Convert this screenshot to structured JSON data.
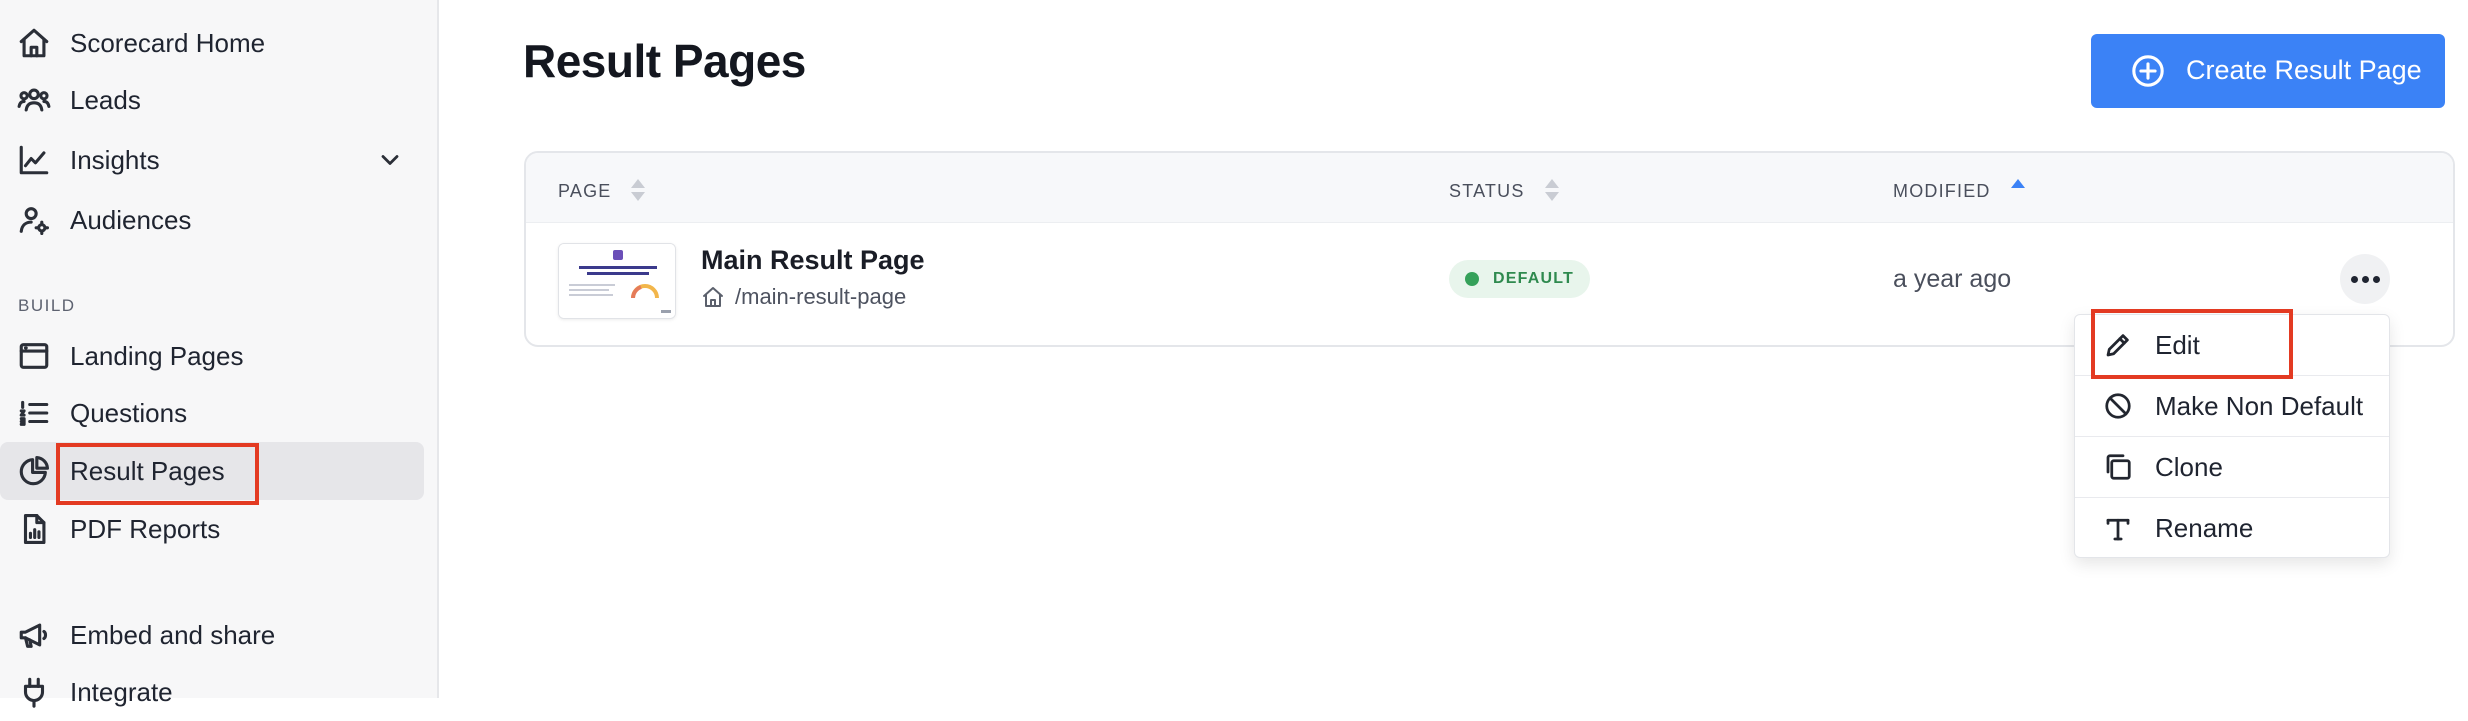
{
  "sidebar": {
    "items": [
      {
        "label": "Scorecard Home",
        "icon": "home-icon"
      },
      {
        "label": "Leads",
        "icon": "users-icon"
      },
      {
        "label": "Insights",
        "icon": "chart-line-icon"
      },
      {
        "label": "Audiences",
        "icon": "user-settings-icon"
      },
      {
        "label": "Landing Pages",
        "icon": "browser-window-icon"
      },
      {
        "label": "Questions",
        "icon": "list-ordered-icon"
      },
      {
        "label": "Result Pages",
        "icon": "pie-chart-icon"
      },
      {
        "label": "PDF Reports",
        "icon": "document-report-icon"
      },
      {
        "label": "Embed and share",
        "icon": "megaphone-icon"
      },
      {
        "label": "Integrate",
        "icon": "plug-icon"
      }
    ],
    "section_build": "BUILD",
    "active_item": "Result Pages"
  },
  "main": {
    "title": "Result Pages",
    "create_button": "Create Result Page",
    "table": {
      "columns": [
        "PAGE",
        "STATUS",
        "MODIFIED"
      ],
      "sorted_column": "MODIFIED",
      "rows": [
        {
          "title": "Main Result Page",
          "slug": "/main-result-page",
          "status": "DEFAULT",
          "modified": "a year ago"
        }
      ]
    },
    "row_menu": {
      "items": [
        {
          "label": "Edit",
          "icon": "pencil-icon"
        },
        {
          "label": "Make Non Default",
          "icon": "ban-icon"
        },
        {
          "label": "Clone",
          "icon": "copy-icon"
        },
        {
          "label": "Rename",
          "icon": "text-type-icon"
        }
      ]
    }
  },
  "colors": {
    "accent": "#3b82f6",
    "highlight": "#e33a22",
    "status_green": "#2f8a4f"
  }
}
